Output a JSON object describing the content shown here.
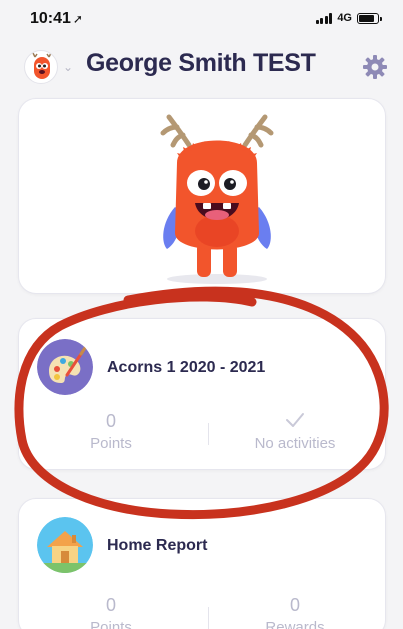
{
  "status_bar": {
    "time": "10:41",
    "network": "4G"
  },
  "header": {
    "title": "George Smith TEST"
  },
  "class_card": {
    "title": "Acorns 1 2020 - 2021",
    "points_value": "0",
    "points_label": "Points",
    "activities_label": "No activities"
  },
  "report_card": {
    "title": "Home Report",
    "points_value": "0",
    "points_label": "Points",
    "rewards_value": "0",
    "rewards_label": "Rewards"
  },
  "colors": {
    "annotation_circle": "#c8321e",
    "monster_orange": "#f2552c",
    "title_navy": "#2c2a50",
    "muted_text": "#b9b9cc"
  }
}
